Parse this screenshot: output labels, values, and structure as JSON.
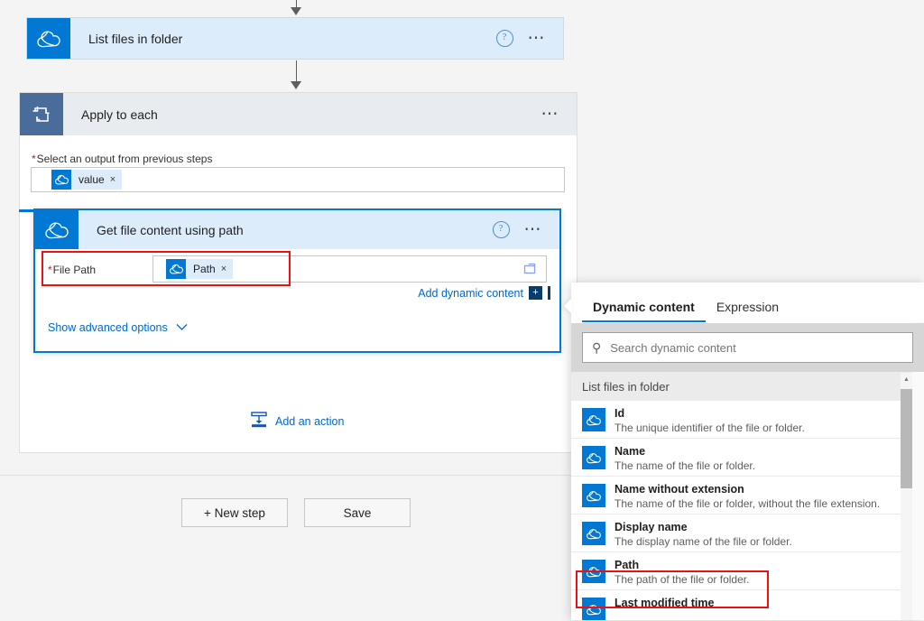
{
  "colors": {
    "accent": "#0078d4",
    "card_selected_border": "#0078d4",
    "card_header_bg": "#dcecfa",
    "scope_header_bg": "#e8ebf0",
    "scope_icon_bg": "#4a6c9b",
    "annotation_red": "#ee1111",
    "link": "#0066cc",
    "required_star": "#a4262c",
    "canvas_bg": "#f4f4f4"
  },
  "flow": {
    "list_files_step": {
      "title": "List files in folder",
      "icon": "onedrive-cloud-icon",
      "help_icon": "help-circle-icon",
      "more_icon": "ellipsis-icon"
    },
    "apply_to_each_step": {
      "title": "Apply to each",
      "icon": "loop-repeat-icon",
      "more_icon": "ellipsis-icon",
      "output_field": {
        "label": "Select an output from previous steps",
        "required_marker": "*",
        "token": {
          "label": "value",
          "remove_glyph": "×",
          "icon": "onedrive-cloud-icon"
        }
      }
    },
    "get_file_content_step": {
      "title": "Get file content using path",
      "icon": "onedrive-cloud-icon",
      "help_icon": "help-circle-icon",
      "more_icon": "ellipsis-icon",
      "file_path_field": {
        "label": "File Path",
        "required_marker": "*",
        "token": {
          "label": "Path",
          "remove_glyph": "×",
          "icon": "onedrive-cloud-icon"
        },
        "picker_icon": "folder-picker-icon"
      },
      "add_dynamic_content_label": "Add dynamic content",
      "add_dynamic_content_badge": "+",
      "show_advanced_options_label": "Show advanced options",
      "show_advanced_chevron": "chevron-down-icon"
    },
    "add_action_label": "Add an action",
    "add_action_icon": "insert-action-icon"
  },
  "commandbar": {
    "new_step_label": "+ New step",
    "save_label": "Save"
  },
  "dynamic_content_panel": {
    "tabs": [
      {
        "label": "Dynamic content",
        "active": true
      },
      {
        "label": "Expression",
        "active": false
      }
    ],
    "search": {
      "placeholder": "Search dynamic content",
      "value": "",
      "icon": "search-icon"
    },
    "group_header": "List files in folder",
    "items": [
      {
        "name": "Id",
        "description": "The unique identifier of the file or folder.",
        "icon": "onedrive-cloud-icon",
        "highlighted": false
      },
      {
        "name": "Name",
        "description": "The name of the file or folder.",
        "icon": "onedrive-cloud-icon",
        "highlighted": false
      },
      {
        "name": "Name without extension",
        "description": "The name of the file or folder, without the file extension.",
        "icon": "onedrive-cloud-icon",
        "highlighted": false
      },
      {
        "name": "Display name",
        "description": "The display name of the file or folder.",
        "icon": "onedrive-cloud-icon",
        "highlighted": false
      },
      {
        "name": "Path",
        "description": "The path of the file or folder.",
        "icon": "onedrive-cloud-icon",
        "highlighted": true
      },
      {
        "name": "Last modified time",
        "description": "",
        "icon": "onedrive-cloud-icon",
        "highlighted": false
      }
    ],
    "scrollbar": {
      "up_arrow_glyph": "▲",
      "icon": "scrollbar-up-arrow-icon"
    }
  }
}
